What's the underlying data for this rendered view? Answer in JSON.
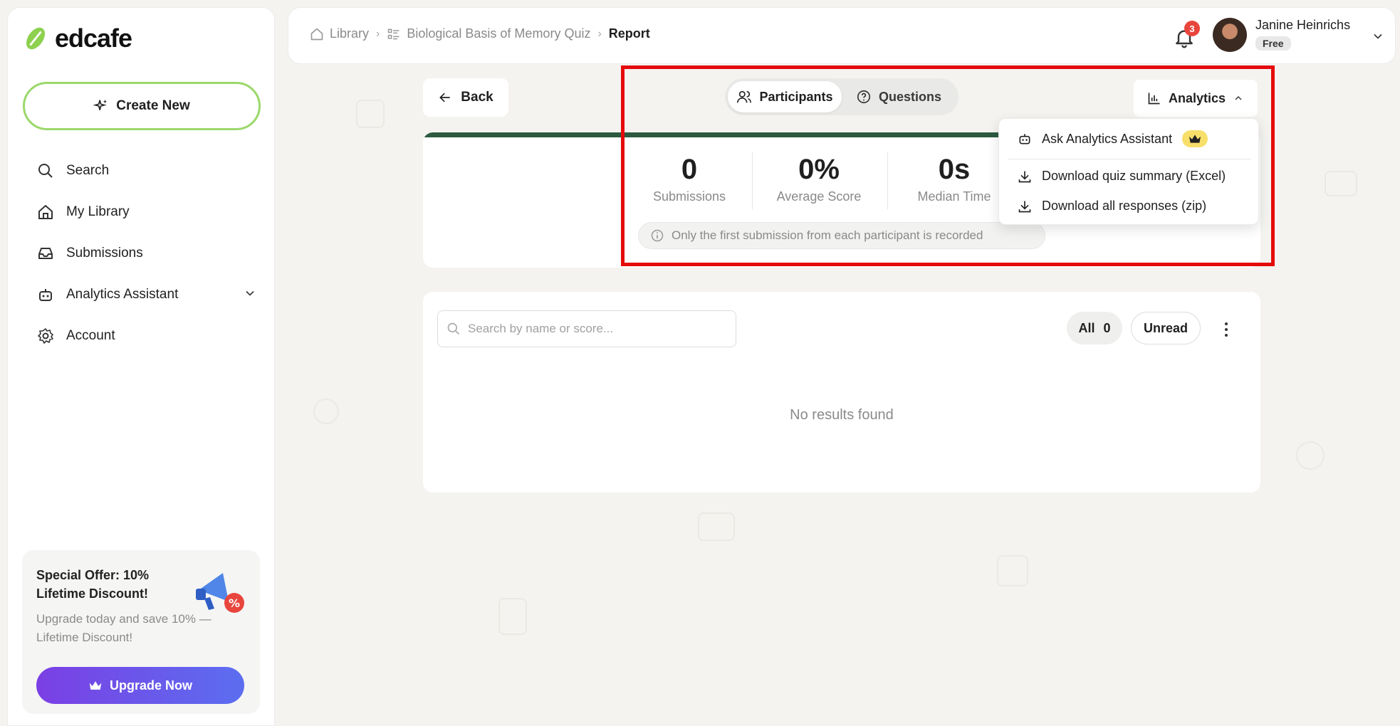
{
  "app": {
    "logo_text": "edcafe",
    "create_label": "Create New"
  },
  "sidebar": {
    "items": [
      {
        "label": "Search",
        "icon": "search-icon"
      },
      {
        "label": "My Library",
        "icon": "home-icon"
      },
      {
        "label": "Submissions",
        "icon": "inbox-icon"
      },
      {
        "label": "Analytics Assistant",
        "icon": "robot-icon"
      },
      {
        "label": "Account",
        "icon": "gear-icon"
      }
    ]
  },
  "promo": {
    "title": "Special Offer: 10% Lifetime Discount!",
    "text": "Upgrade today and save 10% — Lifetime Discount!",
    "button_label": "Upgrade Now"
  },
  "breadcrumb": {
    "items": [
      "Library",
      "Biological Basis of Memory Quiz",
      "Report"
    ]
  },
  "user": {
    "name": "Janine Heinrichs",
    "plan": "Free",
    "notifications": "3"
  },
  "main": {
    "back_label": "Back",
    "tabs": [
      {
        "label": "Participants",
        "active": true
      },
      {
        "label": "Questions",
        "active": false
      }
    ],
    "analytics_label": "Analytics",
    "stats": [
      {
        "value": "0",
        "label": "Submissions"
      },
      {
        "value": "0%",
        "label": "Average Score"
      },
      {
        "value": "0s",
        "label": "Median Time"
      }
    ],
    "notice": "Only the first submission from each participant is recorded",
    "search_placeholder": "Search by name or score...",
    "filters": {
      "all_label": "All",
      "all_count": "0",
      "unread_label": "Unread"
    },
    "empty_text": "No results found"
  },
  "dropdown": {
    "items": [
      {
        "label": "Ask Analytics Assistant",
        "icon": "robot-icon",
        "premium": true
      },
      {
        "label": "Download quiz summary (Excel)",
        "icon": "download-icon"
      },
      {
        "label": "Download all responses (zip)",
        "icon": "download-icon"
      }
    ]
  },
  "colors": {
    "accent_green": "#9bd86b",
    "progress_dark_green": "#2c5a3f",
    "upgrade_gradient_start": "#7b3fe4",
    "upgrade_gradient_end": "#5b6ef0",
    "badge_red": "#e8453c",
    "highlight_red": "#e50b0b"
  }
}
